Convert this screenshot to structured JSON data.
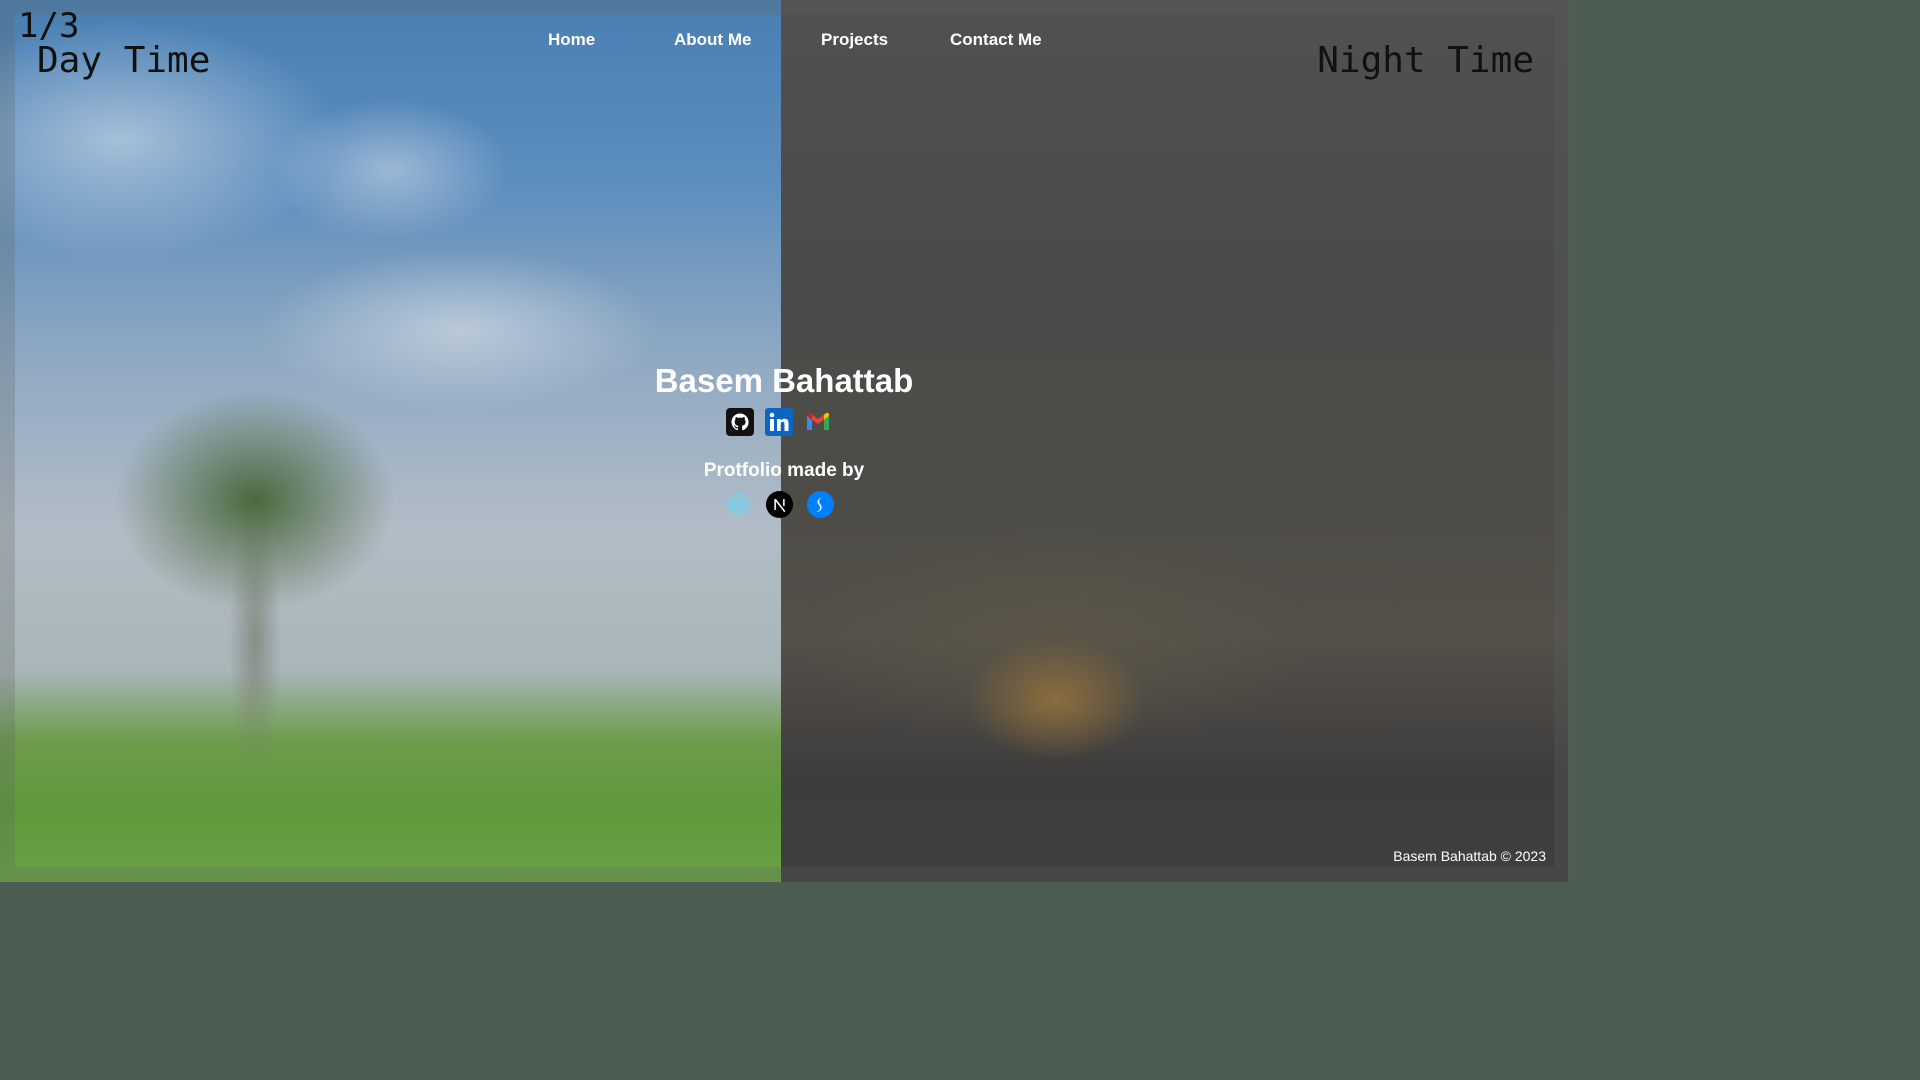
{
  "slide_counter": "1/3",
  "day_label": "Day Time",
  "night_label": "Night Time",
  "nav": {
    "items": [
      {
        "label": "Home"
      },
      {
        "label": "About Me"
      },
      {
        "label": "Projects"
      },
      {
        "label": "Contact Me"
      }
    ]
  },
  "hero": {
    "name": "Basem Bahattab",
    "socials": [
      {
        "icon": "github-icon"
      },
      {
        "icon": "linkedin-icon"
      },
      {
        "icon": "gmail-icon"
      }
    ],
    "made_by_label": "Protfolio made by",
    "tech": [
      {
        "icon": "react-icon"
      },
      {
        "icon": "nextjs-icon"
      },
      {
        "icon": "swiper-icon"
      }
    ]
  },
  "footer": {
    "text": "Basem Bahattab © 2023"
  },
  "colors": {
    "day_sky": "#4a7fb3",
    "grass": "#6aa246",
    "night": "#4a4b4a",
    "text": "#ffffff",
    "label_text": "#111111",
    "react": "#61dafb",
    "linkedin": "#0a66c2",
    "swiper": "#0080ff"
  }
}
